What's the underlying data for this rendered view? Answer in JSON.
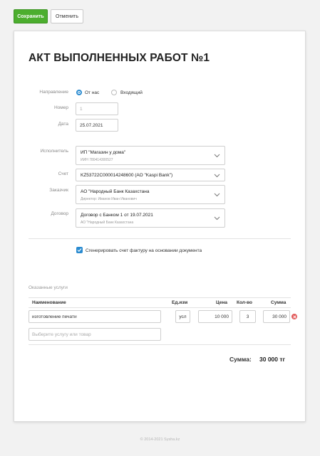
{
  "toolbar": {
    "save_label": "Сохранить",
    "cancel_label": "Отменить"
  },
  "document": {
    "title": "АКТ ВЫПОЛНЕННЫХ РАБОТ №1"
  },
  "form": {
    "direction": {
      "label": "Направление",
      "options": [
        "От нас",
        "Входящий"
      ],
      "selected": "От нас"
    },
    "number": {
      "label": "Номер",
      "placeholder": "1"
    },
    "date": {
      "label": "Дата",
      "value": "25.07.2021"
    },
    "executor": {
      "label": "Исполнитель",
      "value": "ИП \"Магазин у дома\"",
      "sub": "ИИН 780414300527"
    },
    "account": {
      "label": "Счет",
      "value": "KZ53722C000014248600 (АО \"Kaspi Bank\")"
    },
    "customer": {
      "label": "Заказчик",
      "value": "АО \"Народный Банк Казахстана",
      "sub": "Директор: Иванов Иван Иванович"
    },
    "contract": {
      "label": "Договор",
      "value": "Договор с Банком 1 от 19.07.2021",
      "sub": "АО \"Народный Банк Казахстана"
    },
    "generate_invoice": {
      "checked": true,
      "label": "Сгенерировать счет фактуру на основании документа"
    }
  },
  "services": {
    "title": "Оказанные услуги",
    "columns": [
      "Наименование",
      "Ед.изм",
      "Цена",
      "Кол-во",
      "Сумма"
    ],
    "rows": [
      {
        "name": "изготовление печати",
        "unit": "усл",
        "price": "10 000",
        "qty": "3",
        "sum": "30 000"
      }
    ],
    "add_placeholder": "Выберите услугу или товар"
  },
  "total": {
    "label": "Сумма:",
    "value": "30 000 тг"
  },
  "footer": {
    "text": "© 2014-2021 Sysha.kz"
  }
}
